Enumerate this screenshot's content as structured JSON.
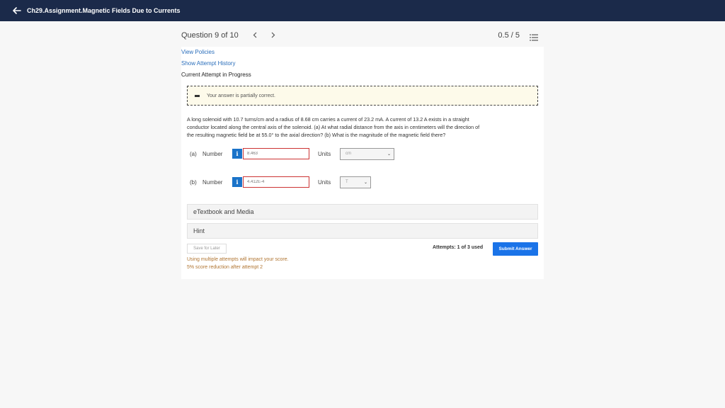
{
  "header": {
    "back_icon": "arrow-left-icon",
    "title": "Ch29.Assignment.Magnetic Fields Due to Currents"
  },
  "question_nav": {
    "position": "Question 9 of 10",
    "prev_icon": "chevron-left-icon",
    "next_icon": "chevron-right-icon",
    "score": "0.5 / 5",
    "list_icon": "list-icon"
  },
  "links": {
    "view_policies": "View Policies",
    "attempt_history": "Show Attempt History"
  },
  "attempt_status": "Current Attempt in Progress",
  "feedback": {
    "text": "Your answer is partially correct.",
    "colors": {
      "border": "#444444",
      "background": "#fdfaea"
    }
  },
  "question": {
    "line1": "A long solenoid with 10.7 turns/cm and a radius of 8.68 cm carries a current of 23.2 mA. A current of 13.2 A exists in a straight",
    "line2": "conductor located along the central axis of the solenoid. (a) At what radial distance from the axis in centimeters will the direction of",
    "line3": "the resulting magnetic field be at 55.0° to the axial direction? (b) What is the magnitude of the magnetic field there?"
  },
  "parts": [
    {
      "part_label": "(a)",
      "number_label": "Number",
      "info_icon": "i",
      "value": "8.463",
      "units_label": "Units",
      "unit": "cm",
      "chevron": "⌄"
    },
    {
      "part_label": "(b)",
      "number_label": "Number",
      "info_icon": "i",
      "value": "4.412E-4",
      "units_label": "Units",
      "unit": "T",
      "chevron": "⌄"
    }
  ],
  "panels": {
    "etextbook": "eTextbook and Media",
    "hint": "Hint"
  },
  "actions": {
    "save_later": "Save for Later",
    "attempts_used": "Attempts: 1 of 3 used",
    "submit": "Submit Answer"
  },
  "notes": {
    "line1": "Using multiple attempts will impact your score.",
    "line2": "5% score reduction after attempt 2"
  },
  "colors": {
    "topbar": "#1b2a4a",
    "accent": "#1a73e8",
    "error_border": "#cc3333",
    "note": "#b07430"
  }
}
